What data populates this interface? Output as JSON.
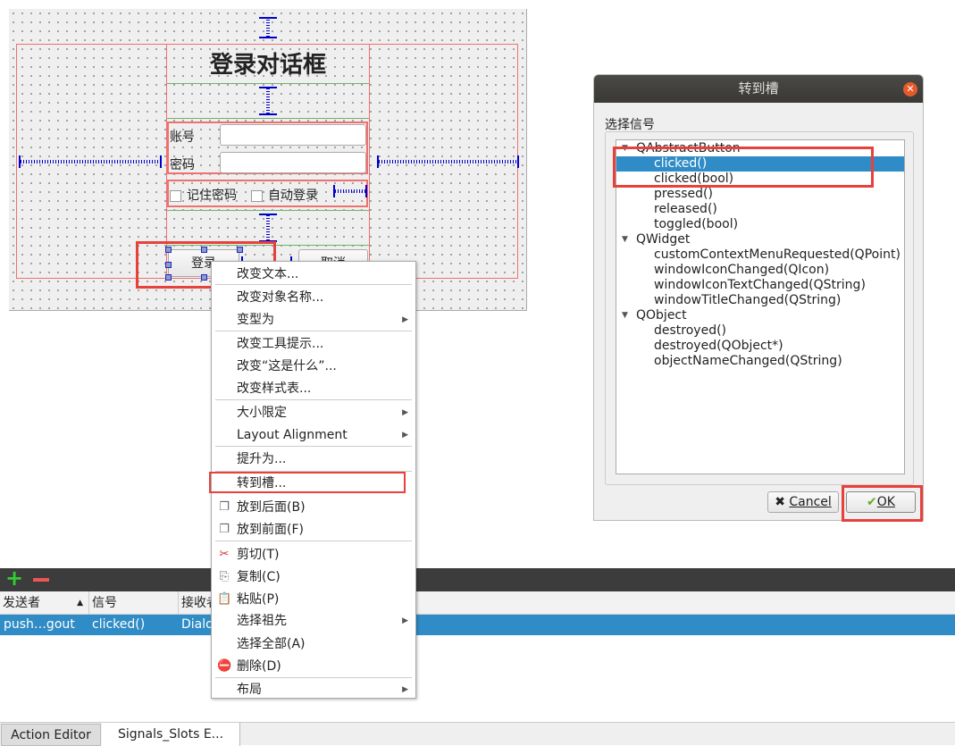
{
  "form": {
    "title": "登录对话框",
    "account_label": "账号",
    "password_label": "密码",
    "remember": "记住密码",
    "autologin": "自动登录",
    "login_btn": "登录",
    "cancel_btn": "取消"
  },
  "context_menu": {
    "items": [
      {
        "label": "改变文本..."
      },
      {
        "label": "改变对象名称..."
      },
      {
        "label": "变型为",
        "submenu": true
      },
      {
        "label": "改变工具提示..."
      },
      {
        "label": "改变“这是什么”..."
      },
      {
        "label": "改变样式表..."
      },
      {
        "label": "大小限定",
        "submenu": true
      },
      {
        "label": "Layout Alignment",
        "submenu": true
      },
      {
        "label": "提升为..."
      },
      {
        "label": "转到槽..."
      },
      {
        "label": "放到后面(B)",
        "icon": "send-to-back-icon"
      },
      {
        "label": "放到前面(F)",
        "icon": "bring-to-front-icon"
      },
      {
        "label": "剪切(T)",
        "icon": "scissors-icon"
      },
      {
        "label": "复制(C)",
        "icon": "copy-icon"
      },
      {
        "label": "粘贴(P)",
        "icon": "paste-icon"
      },
      {
        "label": "选择祖先",
        "submenu": true
      },
      {
        "label": "选择全部(A)"
      },
      {
        "label": "删除(D)",
        "icon": "delete-icon"
      },
      {
        "label": "布局",
        "submenu": true
      }
    ]
  },
  "dialog": {
    "title": "转到槽",
    "group_label": "选择信号",
    "tree": [
      {
        "label": "QAbstractButton",
        "level": 0
      },
      {
        "label": "clicked()",
        "level": 1,
        "selected": true
      },
      {
        "label": "clicked(bool)",
        "level": 1
      },
      {
        "label": "pressed()",
        "level": 1
      },
      {
        "label": "released()",
        "level": 1
      },
      {
        "label": "toggled(bool)",
        "level": 1
      },
      {
        "label": "QWidget",
        "level": 0
      },
      {
        "label": "customContextMenuRequested(QPoint)",
        "level": 1
      },
      {
        "label": "windowIconChanged(QIcon)",
        "level": 1
      },
      {
        "label": "windowIconTextChanged(QString)",
        "level": 1
      },
      {
        "label": "windowTitleChanged(QString)",
        "level": 1
      },
      {
        "label": "QObject",
        "level": 0
      },
      {
        "label": "destroyed()",
        "level": 1
      },
      {
        "label": "destroyed(QObject*)",
        "level": 1
      },
      {
        "label": "objectNameChanged(QString)",
        "level": 1
      }
    ],
    "cancel": "Cancel",
    "ok": "OK"
  },
  "signals_editor": {
    "columns": [
      "发送者",
      "信号",
      "接收者"
    ],
    "rows": [
      {
        "sender": "push…gout",
        "signal": "clicked()",
        "receiver": "Dialog"
      }
    ]
  },
  "tabs": [
    "Action Editor",
    "Signals_Slots E..."
  ],
  "colors": {
    "highlight": "#e8413c",
    "selection": "#308cc6"
  }
}
